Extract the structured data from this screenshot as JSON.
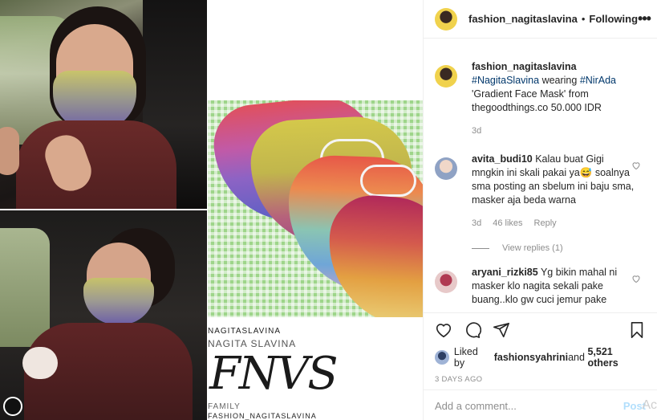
{
  "header": {
    "username": "fashion_nagitaslavina",
    "separator": "•",
    "follow_label": "Following",
    "more_icon": "more-icon",
    "more_glyph": "•••"
  },
  "caption": {
    "username": "fashion_nagitaslavina",
    "tag1": "#NagitaSlavina",
    "text1": " wearing ",
    "tag2": "#NirAda",
    "text2": " 'Gradient Face Mask' from thegoodthings.co 50.000 IDR",
    "time": "3d"
  },
  "comments": [
    {
      "username": "avita_budi10",
      "text": " Kalau buat Gigi mngkin ini skali pakai ya😅 soalnya sma posting an sbelum ini baju sma, masker aja beda warna",
      "time": "3d",
      "likes": "46 likes",
      "reply_label": "Reply",
      "view_replies": "View replies (1)"
    },
    {
      "username": "aryani_rizki85",
      "text": " Yg bikin mahal ni masker klo nagita sekali pake buang..klo gw cuci jemur pake"
    }
  ],
  "likes": {
    "prefix": "Liked by ",
    "user": "fashionsyahrini",
    "middle": " and ",
    "count": "5,521 others"
  },
  "post_age": "3 DAYS AGO",
  "comment_input": {
    "placeholder": "Add a comment...",
    "post_label": "Post",
    "overlay": "Ac"
  },
  "watermark": {
    "line1": "NAGITASLAVINA",
    "line2": "NAGITA SLAVINA",
    "monogram": "FNVS",
    "line4": "FAMILY",
    "line5": "FASHION_NAGITASLAVINA"
  },
  "colors": {
    "link": "#00376b",
    "muted": "#8e8e8e",
    "post_disabled": "#b2dffc"
  }
}
